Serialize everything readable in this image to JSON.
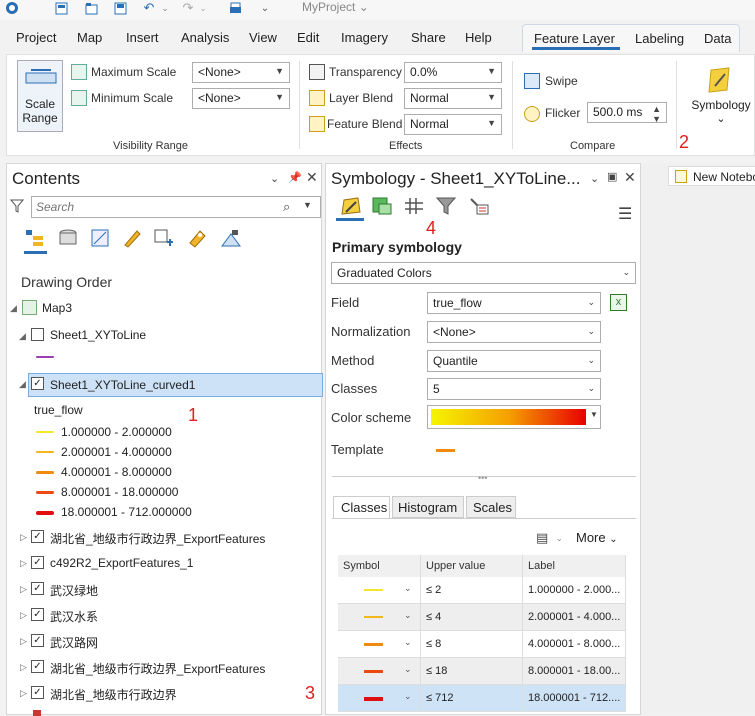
{
  "app": {
    "title": "MyProject",
    "title_chevron": "⌄"
  },
  "menu": {
    "items": [
      "Project",
      "Map",
      "Insert",
      "Analysis",
      "View",
      "Edit",
      "Imagery",
      "Share",
      "Help"
    ],
    "contextual_tabs": [
      "Feature Layer",
      "Labeling",
      "Data"
    ],
    "active_tab": "Feature Layer"
  },
  "ribbon": {
    "scale_range_label_1": "Scale",
    "scale_range_label_2": "Range",
    "maximum_scale_label": "Maximum Scale",
    "maximum_scale_value": "<None>",
    "minimum_scale_label": "Minimum Scale",
    "minimum_scale_value": "<None>",
    "visibility_range_group": "Visibility Range",
    "transparency_label": "Transparency",
    "transparency_value": "0.0%",
    "layer_blend_label": "Layer Blend",
    "layer_blend_value": "Normal",
    "feature_blend_label": "Feature Blend",
    "feature_blend_value": "Normal",
    "effects_group": "Effects",
    "swipe_label": "Swipe",
    "flicker_label": "Flicker",
    "flicker_value": "500.0  ms",
    "compare_group": "Compare",
    "symbology_label": "Symbology",
    "symbology_chevron": "⌄"
  },
  "contents": {
    "title": "Contents",
    "search_placeholder": "Search",
    "drawing_order": "Drawing Order",
    "map_name": "Map3",
    "layer_1": "Sheet1_XYToLine",
    "layer_2": "Sheet1_XYToLine_curved1",
    "field_name": "true_flow",
    "legend": [
      {
        "label": "1.000000 - 2.000000",
        "color": "#f5e62a"
      },
      {
        "label": "2.000001 - 4.000000",
        "color": "#f2b81a"
      },
      {
        "label": "4.000001 - 8.000000",
        "color": "#f08a12"
      },
      {
        "label": "8.000001 - 18.000000",
        "color": "#ec4a10"
      },
      {
        "label": "18.000001 - 712.000000",
        "color": "#e01010"
      }
    ],
    "other_layers": [
      "湖北省_地级市行政边界_ExportFeatures",
      "c492R2_ExportFeatures_1",
      "武汉绿地",
      "武汉水系",
      "武汉路网",
      "湖北省_地级市行政边界_ExportFeatures",
      "湖北省_地级市行政边界"
    ]
  },
  "symbology": {
    "title": "Symbology - Sheet1_XYToLine...",
    "primary_symbology": "Primary symbology",
    "renderer": "Graduated Colors",
    "field_label": "Field",
    "field_value": "true_flow",
    "normalization_label": "Normalization",
    "normalization_value": "<None>",
    "method_label": "Method",
    "method_value": "Quantile",
    "classes_label": "Classes",
    "classes_value": "5",
    "color_scheme_label": "Color scheme",
    "template_label": "Template",
    "tabs": [
      "Classes",
      "Histogram",
      "Scales"
    ],
    "more_label": "More",
    "table_headers": [
      "Symbol",
      "Upper value",
      "Label"
    ],
    "rows": [
      {
        "upper": "≤  2",
        "label": "1.000000 - 2.000...",
        "color": "#f5e62a"
      },
      {
        "upper": "≤  4",
        "label": "2.000001 - 4.000...",
        "color": "#f2b81a"
      },
      {
        "upper": "≤  8",
        "label": "4.000001 - 8.000...",
        "color": "#f08a12"
      },
      {
        "upper": "≤  18",
        "label": "8.000001 - 18.00...",
        "color": "#ec4a10"
      },
      {
        "upper": "≤  712",
        "label": "18.000001 - 712....",
        "color": "#e01010"
      }
    ]
  },
  "map_view": {
    "notebook_tab": "New Notebook"
  },
  "annotations": [
    "1",
    "2",
    "3",
    "4"
  ]
}
